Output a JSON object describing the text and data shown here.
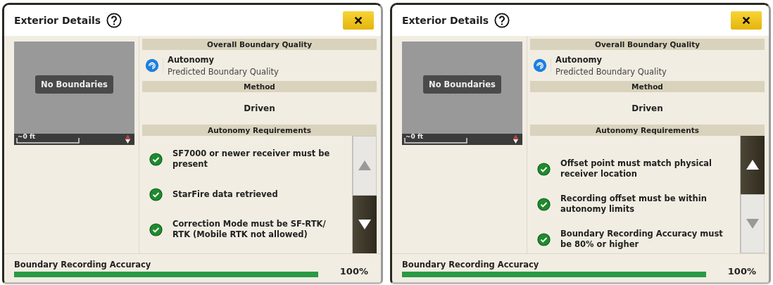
{
  "panels": [
    {
      "title": "Exterior Details",
      "map": {
        "badge": "No Boundaries",
        "scale": "~0 ft"
      },
      "quality_header": "Overall Boundary Quality",
      "quality_name": "Autonomy",
      "quality_sub": "Predicted Boundary Quality",
      "method_header": "Method",
      "method": "Driven",
      "requirements_header": "Autonomy Requirements",
      "requirements": [
        {
          "text": "SF7000 or newer receiver must be present",
          "checked": true
        },
        {
          "text": "StarFire data retrieved",
          "checked": true
        },
        {
          "text": "Correction Mode must be SF-RTK/ RTK (Mobile RTK not allowed)",
          "checked": true
        }
      ],
      "scroll_up": {
        "disabled": true
      },
      "scroll_down": {
        "disabled": false
      },
      "accuracy": {
        "label": "Boundary Recording Accuracy",
        "level": 1,
        "value": "100%"
      }
    },
    {
      "title": "Exterior Details",
      "map": {
        "badge": "No Boundaries",
        "scale": "~0 ft"
      },
      "quality_header": "Overall Boundary Quality",
      "quality_name": "Autonomy",
      "quality_sub": "Predicted Boundary Quality",
      "method_header": "Method",
      "method": "Driven",
      "requirements_header": "Autonomy Requirements",
      "requirements": [
        {
          "text": "Offset point must match physical receiver location",
          "checked": true
        },
        {
          "text": "Recording offset must be within autonomy limits",
          "checked": true
        },
        {
          "text": "Boundary Recording Accuracy must be 80% or higher",
          "checked": true
        }
      ],
      "scroll_up": {
        "disabled": false
      },
      "scroll_down": {
        "disabled": true
      },
      "accuracy": {
        "label": "Boundary Recording Accuracy",
        "level": 1,
        "value": "100%"
      }
    }
  ]
}
